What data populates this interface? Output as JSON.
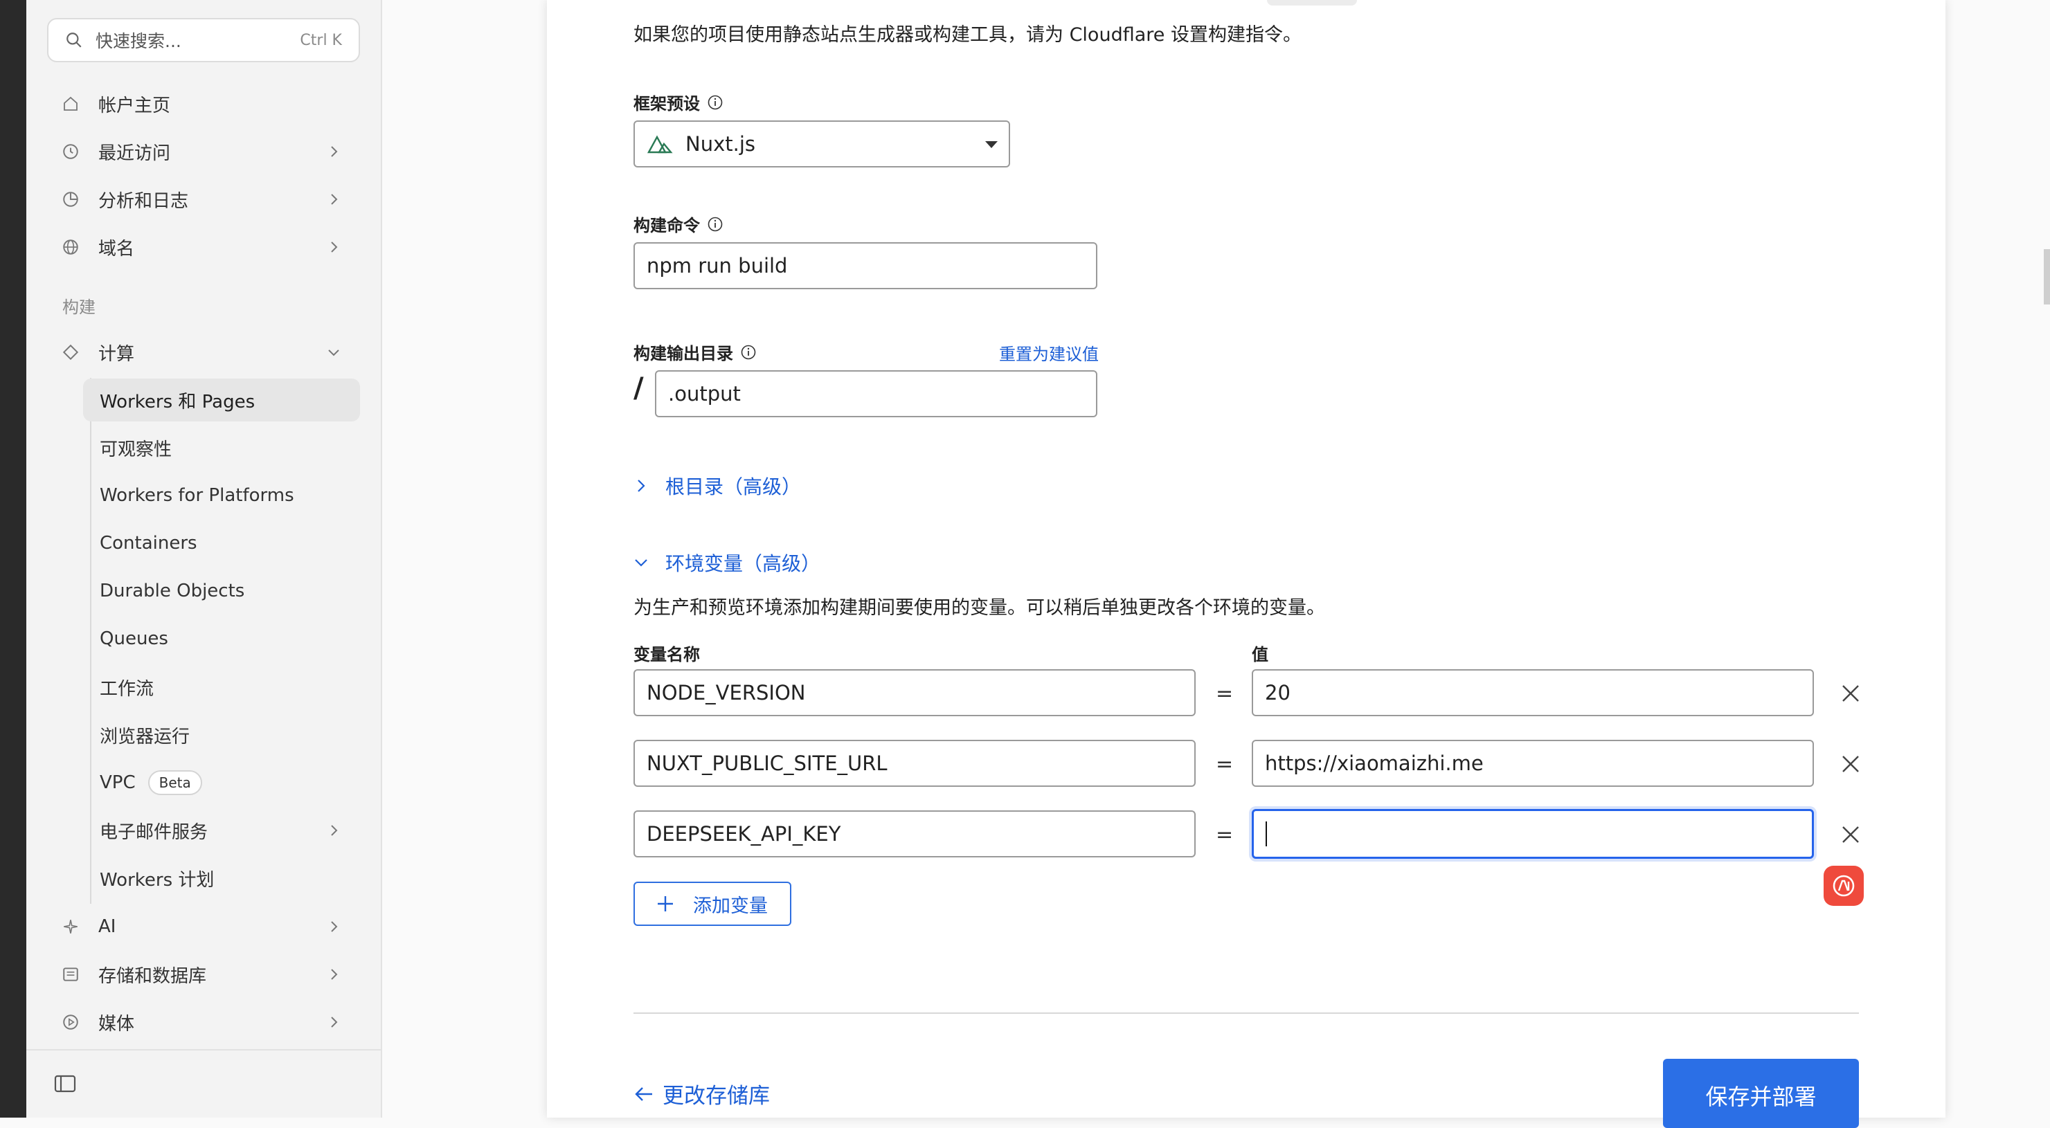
{
  "sidebar": {
    "search": {
      "placeholder": "快速搜索...",
      "shortcut": "Ctrl K"
    },
    "top_items": [
      {
        "label": "帐户主页",
        "icon": "home-icon"
      },
      {
        "label": "最近访问",
        "icon": "history-icon"
      },
      {
        "label": "分析和日志",
        "icon": "chart-pie-icon"
      },
      {
        "label": "域名",
        "icon": "globe-icon"
      }
    ],
    "section_build": "构建",
    "compute": {
      "label": "计算",
      "icon": "compute-icon"
    },
    "compute_sub": [
      {
        "label": "Workers 和 Pages"
      },
      {
        "label": "可观察性"
      },
      {
        "label": "Workers for Platforms"
      },
      {
        "label": "Containers"
      },
      {
        "label": "Durable Objects"
      },
      {
        "label": "Queues"
      },
      {
        "label": "工作流"
      },
      {
        "label": "浏览器运行"
      },
      {
        "label": "VPC",
        "badge": "Beta"
      },
      {
        "label": "电子邮件服务"
      },
      {
        "label": "Workers 计划"
      }
    ],
    "bottom_items": [
      {
        "label": "AI",
        "icon": "sparkle-icon"
      },
      {
        "label": "存储和数据库",
        "icon": "storage-icon"
      },
      {
        "label": "媒体",
        "icon": "media-icon"
      }
    ]
  },
  "form": {
    "intro": "如果您的项目使用静态站点生成器或构建工具，请为 Cloudflare 设置构建指令。",
    "framework": {
      "label": "框架预设",
      "value": "Nuxt.js"
    },
    "build_command": {
      "label": "构建命令",
      "value": "npm run build"
    },
    "output_dir": {
      "label": "构建输出目录",
      "reset_link": "重置为建议值",
      "prefix": "/",
      "value": ".output"
    },
    "root_dir_toggle": "根目录（高级）",
    "env_toggle": "环境变量（高级）",
    "env_desc": "为生产和预览环境添加构建期间要使用的变量。可以稍后单独更改各个环境的变量。",
    "env_name_header": "变量名称",
    "env_value_header": "值",
    "env_vars": [
      {
        "name": "NODE_VERSION",
        "value": "20"
      },
      {
        "name": "NUXT_PUBLIC_SITE_URL",
        "value": "https://xiaomaizhi.me"
      },
      {
        "name": "DEEPSEEK_API_KEY",
        "value": ""
      }
    ],
    "eq_sign": "=",
    "add_variable": "添加变量",
    "back_link": "更改存储库",
    "save_button": "保存并部署"
  },
  "colors": {
    "accent": "#2b6fe6",
    "link": "#1d5fd6",
    "ai_badge": "#ef4a3c"
  }
}
